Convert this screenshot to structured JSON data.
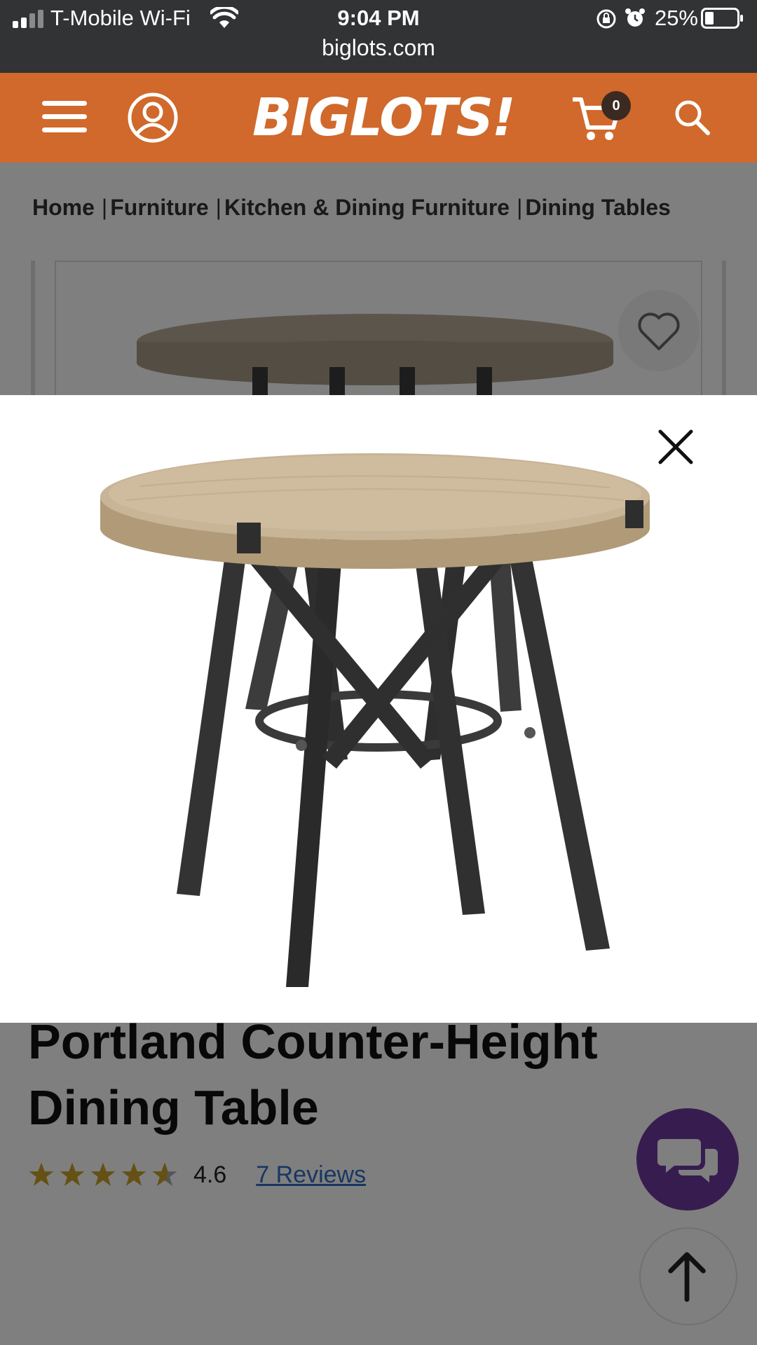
{
  "status_bar": {
    "carrier": "T-Mobile Wi-Fi",
    "time": "9:04 PM",
    "battery": "25%",
    "url": "biglots.com"
  },
  "header": {
    "logo": "BIGLOTS!",
    "cart_count": "0",
    "brand_color": "#d0692b"
  },
  "breadcrumb": [
    "Home",
    "Furniture",
    "Kitchen & Dining Furniture",
    "Dining Tables"
  ],
  "product": {
    "title": "Portland Counter-Height Dining Table",
    "rating": "4.6",
    "reviews_link": "7 Reviews",
    "rating_stars": 4.6
  },
  "icons": {
    "menu": "menu-icon",
    "account": "account-icon",
    "cart": "cart-icon",
    "search": "search-icon",
    "wishlist": "heart-icon",
    "close": "close-icon",
    "chat": "chat-icon",
    "back_to_top": "arrow-up-icon"
  },
  "accent_colors": {
    "chat": "#6e3b9f",
    "star": "#c9a227",
    "link": "#2e6fc4"
  }
}
